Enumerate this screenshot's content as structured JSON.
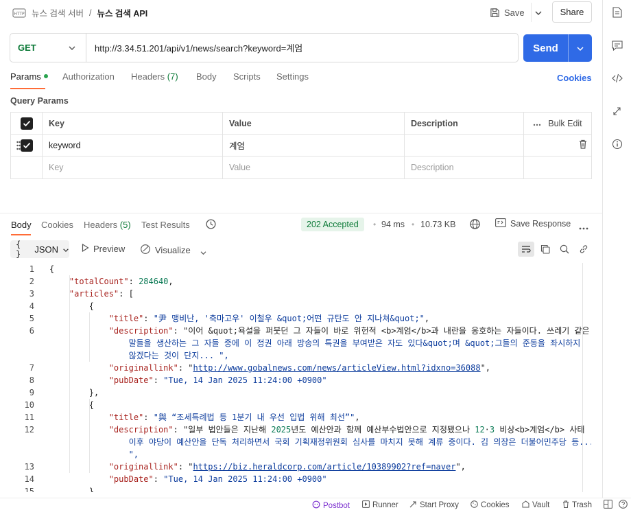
{
  "header": {
    "breadcrumb_parent": "뉴스 검색 서버",
    "breadcrumb_sep": "/",
    "breadcrumb_current": "뉴스 검색 API",
    "save_label": "Save",
    "share_label": "Share"
  },
  "request": {
    "method": "GET",
    "url": "http://3.34.51.201/api/v1/news/search?keyword=계엄",
    "send_label": "Send"
  },
  "request_tabs": [
    {
      "label": "Params",
      "active": true,
      "has_dot": true
    },
    {
      "label": "Authorization"
    },
    {
      "label": "Headers",
      "count": "(7)"
    },
    {
      "label": "Body"
    },
    {
      "label": "Scripts"
    },
    {
      "label": "Settings"
    }
  ],
  "cookies_link": "Cookies",
  "query_params": {
    "title": "Query Params",
    "headers": {
      "key": "Key",
      "value": "Value",
      "description": "Description",
      "bulk_edit": "Bulk Edit"
    },
    "rows": [
      {
        "key": "keyword",
        "value": "계엄",
        "description": "",
        "checked": true
      }
    ],
    "placeholder": {
      "key": "Key",
      "value": "Value",
      "description": "Description"
    }
  },
  "response_tabs": [
    {
      "label": "Body",
      "active": true
    },
    {
      "label": "Cookies"
    },
    {
      "label": "Headers",
      "count": "(5)"
    },
    {
      "label": "Test Results"
    }
  ],
  "response_meta": {
    "status": "202 Accepted",
    "time": "94 ms",
    "size": "10.73 KB",
    "save_response": "Save Response",
    "status_color": "#0d7a38"
  },
  "response_toolbar": {
    "format": "JSON",
    "format_prefix": "{ }",
    "preview": "Preview",
    "visualize": "Visualize"
  },
  "code_lines": [
    {
      "n": "1",
      "t": "{"
    },
    {
      "n": "2",
      "t": "    \"totalCount\": 284640,"
    },
    {
      "n": "3",
      "t": "    \"articles\": ["
    },
    {
      "n": "4",
      "t": "        {"
    },
    {
      "n": "5",
      "t": "            \"title\": \"尹 맹비난, '축마고우' 이철우 &quot;어떤 규탄도 안 지나쳐&quot;\","
    },
    {
      "n": "6",
      "t": "            \"description\": \"이어 &quot;욕설을 퍼붓던 그 자들이 바로 위헌적 <b>계엄</b>과 내란을 옹호하는 자들이다. 쓰레기 같은"
    },
    {
      "n": "",
      "t": "                말들을 생산하는 그 자들 중에 이 정권 아래 방송의 특권을 부여받은 자도 있다&quot;며 &quot;그들의 준동을 좌시하지"
    },
    {
      "n": "",
      "t": "                않겠다는 것이 단지... \","
    },
    {
      "n": "7",
      "t": "            \"originallink\": \"http://www.gobalnews.com/news/articleView.html?idxno=36088\","
    },
    {
      "n": "8",
      "t": "            \"pubDate\": \"Tue, 14 Jan 2025 11:24:00 +0900\""
    },
    {
      "n": "9",
      "t": "        },"
    },
    {
      "n": "10",
      "t": "        {"
    },
    {
      "n": "11",
      "t": "            \"title\": \"與 “조세특례법 등 1분기 내 우선 입법 위해 최선”\","
    },
    {
      "n": "12",
      "t": "            \"description\": \"일부 법안들은 지난해 2025년도 예산안과 함께 예산부수법안으로 지정됐으나 12·3 비상<b>계엄</b> 사태"
    },
    {
      "n": "",
      "t": "                이후 야당이 예산안을 단독 처리하면서 국회 기획재정위원회 심사를 마치지 못해 계류 중이다. 김 의장은 더불어민주당 등..."
    },
    {
      "n": "",
      "t": "                \","
    },
    {
      "n": "13",
      "t": "            \"originallink\": \"https://biz.heraldcorp.com/article/10389902?ref=naver\","
    },
    {
      "n": "14",
      "t": "            \"pubDate\": \"Tue, 14 Jan 2025 11:24:00 +0900\""
    },
    {
      "n": "15",
      "t": "        },"
    }
  ],
  "status_bar": {
    "postbot": "Postbot",
    "runner": "Runner",
    "start_proxy": "Start Proxy",
    "cookies": "Cookies",
    "vault": "Vault",
    "trash": "Trash"
  },
  "colors": {
    "accent": "#ff6c37",
    "send": "#2f6ae6",
    "method_get": "#0d7a38",
    "json_key": "#a8231f",
    "json_string": "#0b3b9c",
    "json_number": "#0b7a55"
  }
}
